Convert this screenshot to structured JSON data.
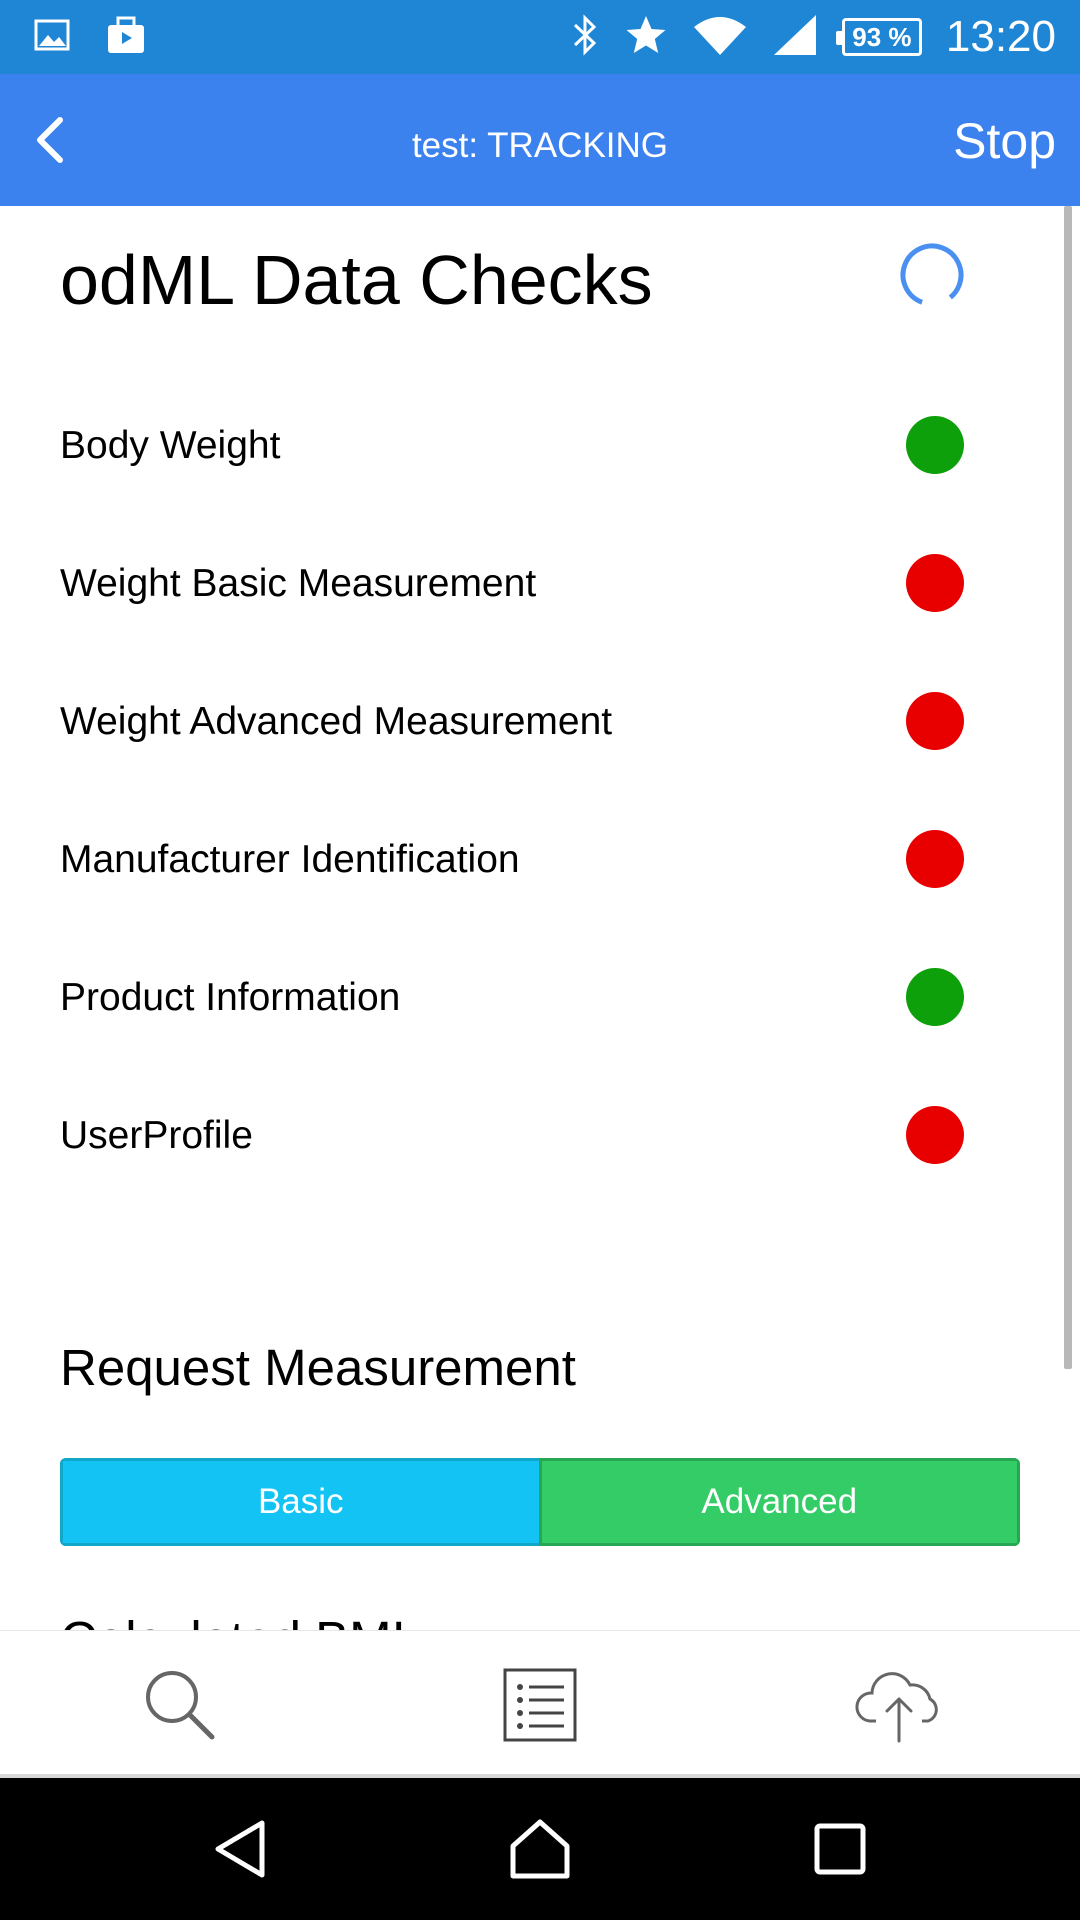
{
  "status_bar": {
    "time": "13:20",
    "battery": "93 %",
    "icons": [
      "gallery-icon",
      "bag-icon",
      "bluetooth-icon",
      "star-icon",
      "wifi-icon",
      "signal-icon"
    ]
  },
  "app_bar": {
    "title": "test: TRACKING",
    "action_label": "Stop",
    "back_icon": "chevron-left-icon"
  },
  "checks": {
    "title": "odML Data Checks",
    "items": [
      {
        "label": "Body Weight",
        "status": "ok",
        "color": "#0ea00a"
      },
      {
        "label": "Weight Basic Measurement",
        "status": "fail",
        "color": "#e80000"
      },
      {
        "label": "Weight Advanced Measurement",
        "status": "fail",
        "color": "#e80000"
      },
      {
        "label": "Manufacturer Identification",
        "status": "fail",
        "color": "#e80000"
      },
      {
        "label": "Product Information",
        "status": "ok",
        "color": "#0ea00a"
      },
      {
        "label": "UserProfile",
        "status": "fail",
        "color": "#e80000"
      }
    ]
  },
  "request": {
    "title": "Request Measurement",
    "basic_label": "Basic",
    "advanced_label": "Advanced"
  },
  "next_section": {
    "partial_title": "Calculated BMI"
  },
  "tab_bar": {
    "tabs": [
      "search-icon",
      "list-icon",
      "cloud-upload-icon"
    ]
  },
  "colors": {
    "status_bar": "#1f86d6",
    "app_bar": "#3b82ee",
    "ok": "#0ea00a",
    "fail": "#e80000",
    "basic": "#13c3f3",
    "advanced": "#33cc66"
  }
}
